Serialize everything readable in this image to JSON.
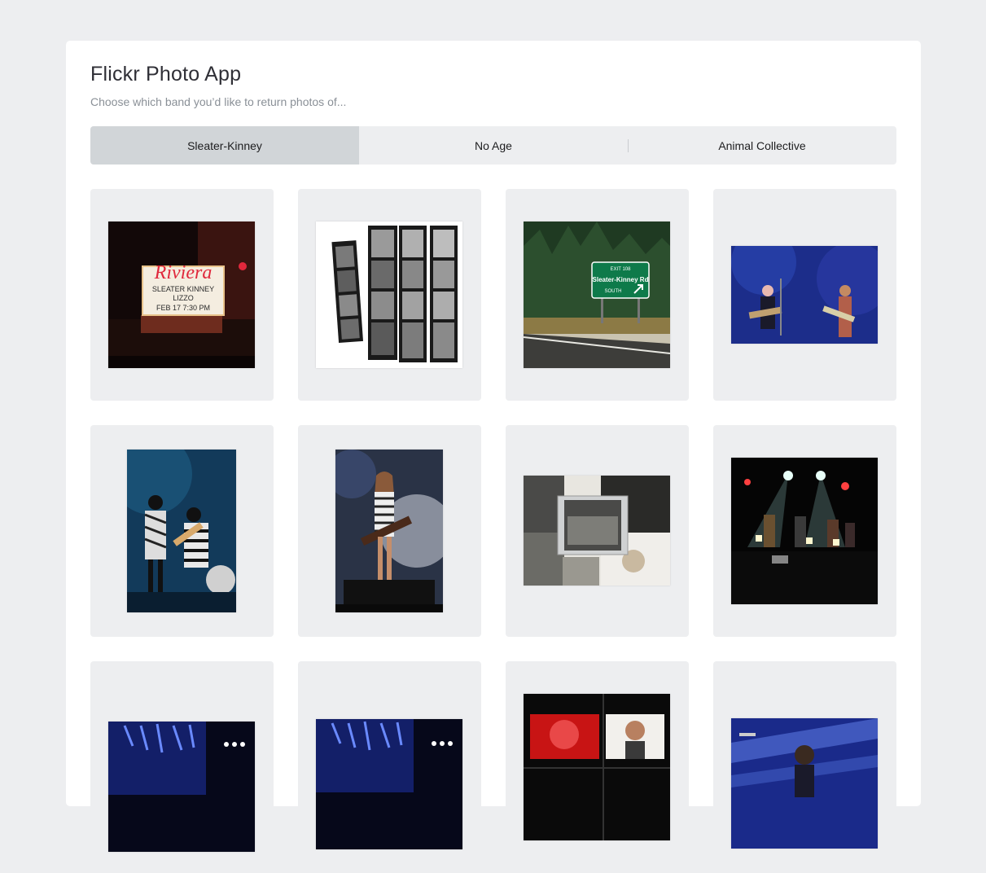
{
  "app": {
    "title": "Flickr Photo App",
    "subtitle": "Choose which band you’d like to return photos of..."
  },
  "tabs": [
    {
      "label": "Sleater-Kinney",
      "active": true
    },
    {
      "label": "No Age",
      "active": false
    },
    {
      "label": "Animal Collective",
      "active": false
    }
  ],
  "colors": {
    "page_bg": "#edeef0",
    "panel_bg": "#ffffff",
    "card_bg": "#edeef0",
    "active_tab": "#d1d5d8"
  },
  "photos": {
    "riviera_marquee": {
      "sign": "Riviera",
      "line1": "SLEATER KINNEY",
      "line2": "LIZZO",
      "line3": "FEB 17  7:30 PM"
    },
    "highway_sign": {
      "exit": "EXIT 108",
      "name": "Sleater-Kinney Rd",
      "direction": "SOUTH"
    }
  }
}
